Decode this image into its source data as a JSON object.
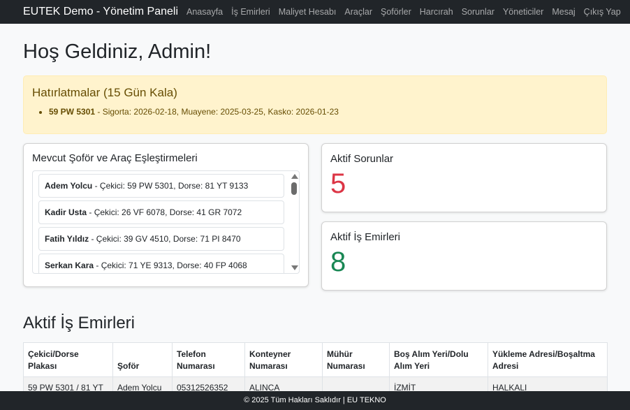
{
  "navbar": {
    "brand": "EUTEK Demo - Yönetim Paneli",
    "links": [
      "Anasayfa",
      "İş Emirleri",
      "Maliyet Hesabı",
      "Araçlar",
      "Şoförler",
      "Harcırah",
      "Sorunlar",
      "Yöneticiler",
      "Mesaj",
      "Çıkış Yap"
    ]
  },
  "page_title": "Hoş Geldiniz, Admin!",
  "reminders": {
    "title": "Hatırlatmalar (15 Gün Kala)",
    "items": [
      {
        "plate": "59 PW 5301",
        "details": " - Sigorta: 2026-02-18, Muayene: 2025-03-25, Kasko: 2026-01-23"
      }
    ]
  },
  "pairings": {
    "title": "Mevcut Şoför ve Araç Eşleştirmeleri",
    "items": [
      {
        "driver": "Adem Yolcu",
        "details": " - Çekici: 59 PW 5301, Dorse: 81 YT 9133"
      },
      {
        "driver": "Kadir Usta",
        "details": " - Çekici: 26 VF 6078, Dorse: 41 GR 7072"
      },
      {
        "driver": "Fatih Yıldız",
        "details": " - Çekici: 39 GV 4510, Dorse: 71 PI 8470"
      },
      {
        "driver": "Serkan Kara",
        "details": " - Çekici: 71 YE 9313, Dorse: 40 FP 4068"
      }
    ]
  },
  "stats": {
    "issues_label": "Aktif Sorunlar",
    "issues_value": "5",
    "orders_label": "Aktif İş Emirleri",
    "orders_value": "8"
  },
  "orders_table": {
    "title": "Aktif İş Emirleri",
    "headers": [
      "Çekici/Dorse Plakası",
      "Şoför",
      "Telefon Numarası",
      "Konteyner Numarası",
      "Mühür Numarası",
      "Boş Alım Yeri/Dolu Alım Yeri",
      "Yükleme Adresi/Boşaltma Adresi"
    ],
    "rows": [
      [
        "59 PW 5301 / 81 YT",
        "Adem Yolcu",
        "05312526352",
        "ALINCA",
        "",
        "İZMİT",
        "HALKALI"
      ]
    ]
  },
  "footer": "© 2025 Tüm Hakları Saklıdır | EU TEKNO"
}
